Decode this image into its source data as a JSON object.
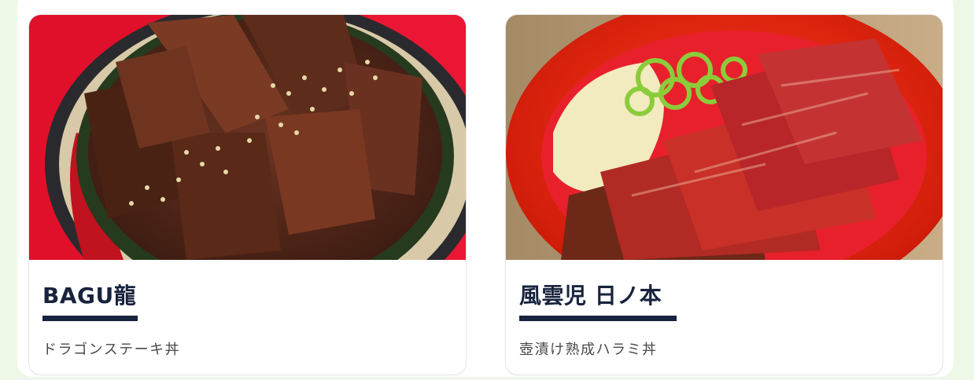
{
  "cards": [
    {
      "title": "BAGU龍",
      "description": "ドラゴンステーキ丼",
      "image": "dragon-steak-bowl-photo"
    },
    {
      "title": "風雲児 日ノ本",
      "description": "壺漬け熟成ハラミ丼",
      "image": "aged-harami-bowl-photo"
    }
  ],
  "colors": {
    "page_background": "#eef8e6",
    "title_text": "#18233d",
    "underline": "#18233d",
    "description_text": "#4a4a4a"
  }
}
